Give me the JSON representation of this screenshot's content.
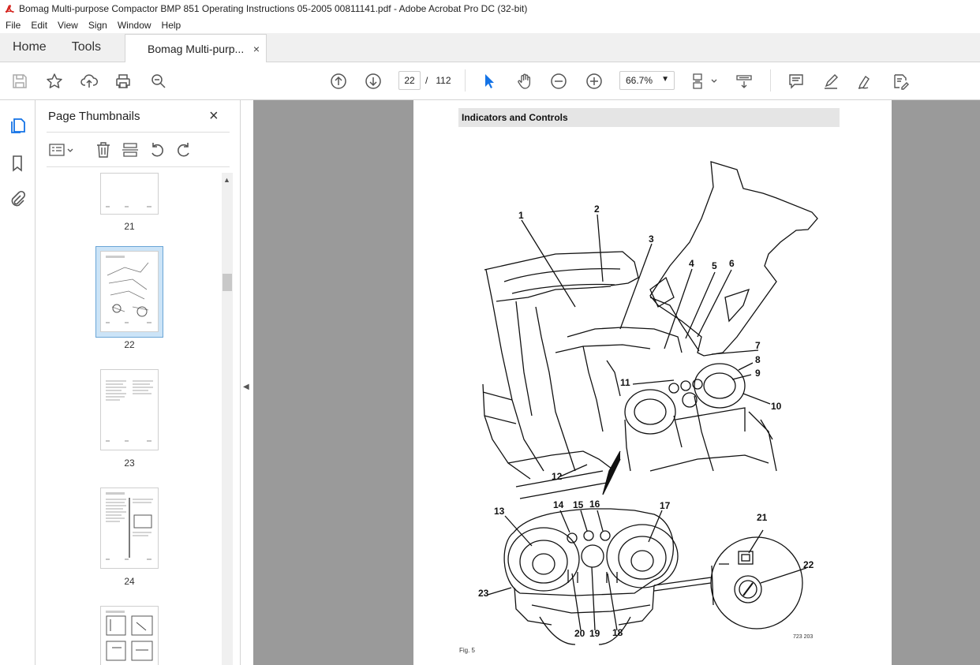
{
  "window": {
    "title": "Bomag Multi-purpose Compactor BMP 851 Operating Instructions 05-2005 00811141.pdf - Adobe Acrobat Pro DC (32-bit)"
  },
  "menu": [
    "File",
    "Edit",
    "View",
    "Sign",
    "Window",
    "Help"
  ],
  "tabs": {
    "home": "Home",
    "tools": "Tools",
    "document": "Bomag Multi-purp...",
    "close": "×"
  },
  "toolbar": {
    "current_page": "22",
    "page_separator": "/",
    "total_pages": "112",
    "zoom": "66.7%"
  },
  "panel": {
    "title": "Page Thumbnails",
    "close": "×",
    "thumbnails": [
      {
        "label": "21",
        "selected": false
      },
      {
        "label": "22",
        "selected": true
      },
      {
        "label": "23",
        "selected": false
      },
      {
        "label": "24",
        "selected": false
      },
      {
        "label": "",
        "selected": false
      }
    ]
  },
  "page": {
    "section_title": "Indicators and Controls",
    "figure_label": "Fig. 5",
    "figure_code": "723 203",
    "callouts": [
      "1",
      "2",
      "3",
      "4",
      "5",
      "6",
      "7",
      "8",
      "9",
      "10",
      "11",
      "12",
      "13",
      "14",
      "15",
      "16",
      "17",
      "18",
      "19",
      "20",
      "21",
      "22",
      "23"
    ]
  },
  "colors": {
    "accent": "#1473e6",
    "doc_background": "#9a9a9a",
    "selection": "#cce4f7"
  }
}
